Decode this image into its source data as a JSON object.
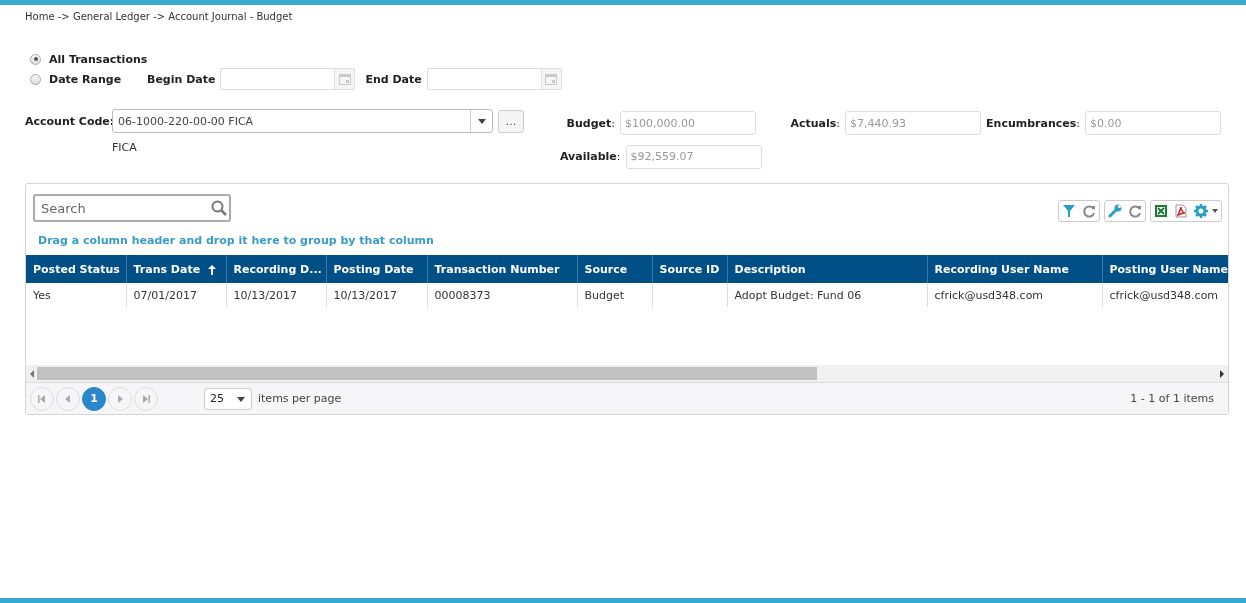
{
  "breadcrumb": "Home -> General Ledger -> Account Journal - Budget",
  "filters": {
    "radios": [
      {
        "label": "All Transactions",
        "selected": true
      },
      {
        "label": "Date Range",
        "selected": false
      }
    ],
    "date_fields": [
      {
        "label": "Begin Date"
      },
      {
        "label": "End Date"
      }
    ]
  },
  "account": {
    "label": "Account Code:",
    "value": "06-1000-220-00-00 FICA",
    "description": "FICA",
    "more_button": "..."
  },
  "summary": [
    {
      "label": "**Budget**:",
      "value": "$100,000.00"
    },
    {
      "label": "**Actuals**:",
      "value": "$7,440.93"
    },
    {
      "label": "**Encumbrances**:",
      "value": "$0.00"
    },
    {
      "label": "**Available**:",
      "value": "$92,559.07"
    }
  ],
  "grid": {
    "search": {
      "placeholder": "Search"
    },
    "group_hint": "Drag a column header and drop it here to group by that column",
    "columns": [
      {
        "label": "Posted Status"
      },
      {
        "label": "Trans Date",
        "sorted": true
      },
      {
        "label": "Recording D..."
      },
      {
        "label": "Posting Date"
      },
      {
        "label": "Transaction Number"
      },
      {
        "label": "Source"
      },
      {
        "label": "Source ID"
      },
      {
        "label": "Description"
      },
      {
        "label": "Recording User Name"
      },
      {
        "label": "Posting User Name"
      }
    ],
    "rows": [
      {
        "cells": [
          "Yes",
          "07/01/2017",
          "10/13/2017",
          "10/13/2017",
          "00008373",
          "Budget",
          "",
          "Adopt Budget: Fund 06",
          "cfrick@usd348.com",
          "cfrick@usd348.com"
        ]
      }
    ],
    "pager": {
      "pages": [
        {
          "label": "1",
          "selected": true
        }
      ],
      "page_size": "25",
      "page_size_label": "items per page",
      "summary": "1 - 1 of 1 items"
    }
  }
}
